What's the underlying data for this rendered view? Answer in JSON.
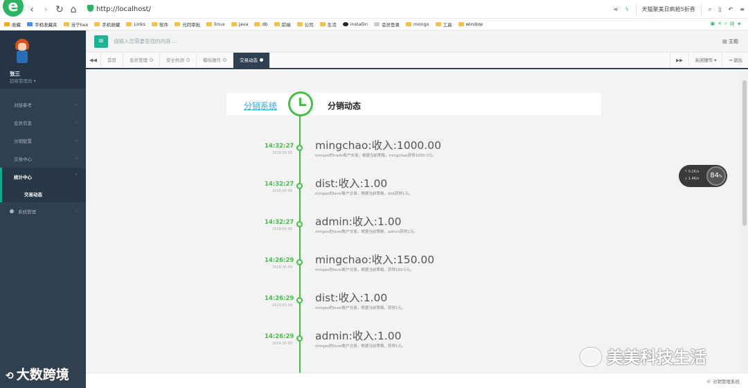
{
  "browser": {
    "logo_letter": "e",
    "address": "http://localhost/",
    "promo_text": "天猫聚美日疯抢5折券",
    "bookmarks": [
      "收藏",
      "手机收藏夹",
      "当宁hex",
      "手机收藏",
      "Links",
      "软件",
      "元同审批",
      "linux",
      "java",
      "db",
      "前端",
      "公司",
      "生活",
      "installin",
      "会员登录",
      "mongo",
      "工具",
      "window"
    ]
  },
  "sidebar": {
    "user_name": "张三",
    "user_role": "超级管理员",
    "menu": [
      {
        "label": "对接参考"
      },
      {
        "label": "会员信息"
      },
      {
        "label": "分销配置"
      },
      {
        "label": "交易中心"
      },
      {
        "label": "统计中心"
      }
    ],
    "submenu_label": "交易动态",
    "system_label": "系统管理"
  },
  "topbar": {
    "search_placeholder": "请输入您需要查找的内容 …",
    "theme_label": "主题"
  },
  "tabs": {
    "items": [
      {
        "label": "首页"
      },
      {
        "label": "会员管理"
      },
      {
        "label": "安全检测"
      },
      {
        "label": "模拟操作"
      },
      {
        "label": "交易动态"
      }
    ],
    "close_ops_label": "关闭操作",
    "logout_label": "退出"
  },
  "timeline": {
    "header_link": "分销系统",
    "header_title": "分销动态",
    "entries": [
      {
        "time": "14:32:27",
        "date": "2018-05-09",
        "title": "mingchao:收入:1000.00",
        "desc": "mingxo的trade账户交易，根据当前策略，mingchao获得1000.0元。"
      },
      {
        "time": "14:32:27",
        "date": "2018-05-09",
        "title": "dist:收入:1.00",
        "desc": "mingxo的level账户交易，根据当前策略，dist获得1元。"
      },
      {
        "time": "14:32:27",
        "date": "2018-05-09",
        "title": "admin:收入:1.00",
        "desc": "mingxo的level账户交易，根据当前策略，admin获得1元。"
      },
      {
        "time": "14:26:29",
        "date": "2018-05-09",
        "title": "mingchao:收入:150.00",
        "desc": "mingxo的level账户交易，根据当前策略，获得150.0元。"
      },
      {
        "time": "14:26:29",
        "date": "2018-05-09",
        "title": "dist:收入:1.00",
        "desc": "mingxo的level账户交易，根据当前策略，获得1元。"
      },
      {
        "time": "14:26:29",
        "date": "2018-05-09",
        "title": "admin:收入:1.00",
        "desc": "mingxo的level账户交易，根据当前策略，获得1元。"
      }
    ]
  },
  "widget": {
    "up": "0.2K/s",
    "down": "1.4K/s",
    "percent": "84"
  },
  "footer": {
    "text": "© 分销管理系统"
  },
  "watermarks": {
    "left": "大数跨境",
    "right": "美美科技生活"
  },
  "colors": {
    "accent": "#1ab394",
    "timeline": "#3ec041",
    "sidebar": "#2f4050",
    "link": "#27a9e3"
  }
}
